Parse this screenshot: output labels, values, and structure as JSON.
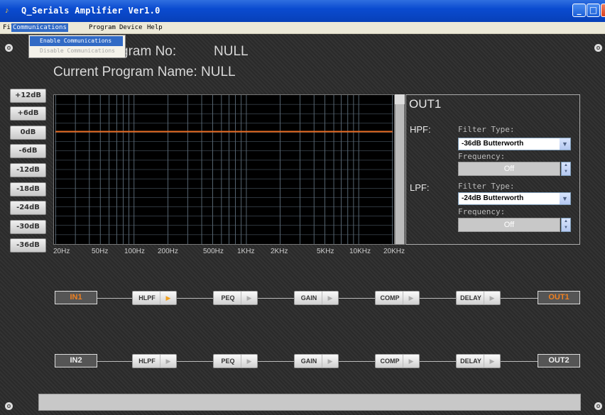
{
  "window": {
    "title": "Q_Serials Amplifier Ver1.0"
  },
  "menu": {
    "items": [
      "File",
      "Communications",
      "Program",
      "Device",
      "Help"
    ]
  },
  "dropdown": {
    "items": [
      "Enable Communications",
      "Disable Communications"
    ]
  },
  "program": {
    "no_label": "gram No:",
    "no_value": "NULL",
    "name_label": "Current Program Name: NULL"
  },
  "db_buttons": [
    "+12dB",
    "+6dB",
    "0dB",
    "-6dB",
    "-12dB",
    "-18dB",
    "-24dB",
    "-30dB",
    "-36dB"
  ],
  "freq_labels": [
    "20Hz",
    "50Hz",
    "100Hz",
    "200Hz",
    "500Hz",
    "1KHz",
    "2KHz",
    "5KHz",
    "10KHz",
    "20KHz"
  ],
  "output_panel": {
    "title": "OUT1",
    "hpf_label": "HPF:",
    "lpf_label": "LPF:",
    "filter_type_label": "Filter Type:",
    "frequency_label": "Frequency:",
    "hpf_type": "-36dB Butterworth",
    "hpf_freq": "Off",
    "lpf_type": "-24dB Butterworth",
    "lpf_freq": "Off"
  },
  "chain1": {
    "in": "IN1",
    "out": "OUT1",
    "blocks": [
      "HLPF",
      "PEQ",
      "GAIN",
      "COMP",
      "DELAY"
    ]
  },
  "chain2": {
    "in": "IN2",
    "out": "OUT2",
    "blocks": [
      "HLPF",
      "PEQ",
      "GAIN",
      "COMP",
      "DELAY"
    ]
  },
  "colors": {
    "accent": "#f08020",
    "curve": "#e86a20",
    "titlebar": "#0a4bd0"
  }
}
